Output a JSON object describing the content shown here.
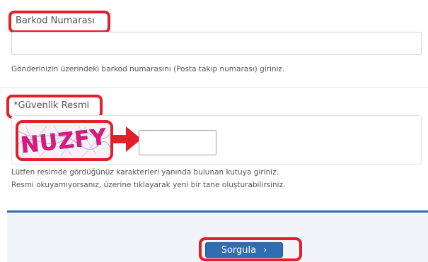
{
  "barkod": {
    "label": "Barkod Numarası",
    "value": "",
    "help": "Gönderinizin üzerindeki barkod numarasını (Posta takip numarası) giriniz."
  },
  "security": {
    "label": "*Güvenlik Resmi",
    "captcha_text": "NUZFY",
    "input_value": "",
    "help_line1": "Lütfen resimde gördüğünüz karakterleri yanında bulunan kutuya giriniz.",
    "help_line2": "Resmi okuyamıyorsanız, üzerine tıklayarak yeni bir tane oluşturabilirsiniz."
  },
  "submit": {
    "label": "Sorgula",
    "chevron_icon": "chevron-right-icon"
  },
  "colors": {
    "highlight": "#e0202a",
    "button": "#2f6db3",
    "captcha_ink": "#e0187e"
  }
}
